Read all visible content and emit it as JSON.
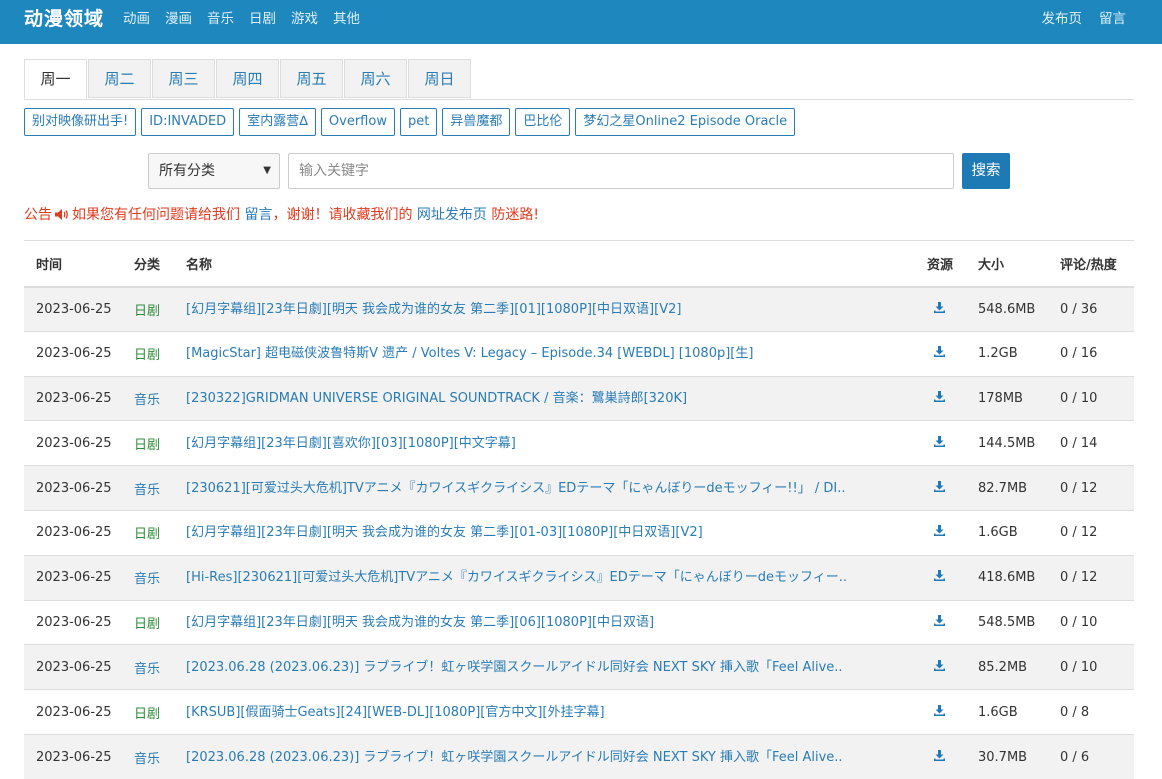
{
  "navbar": {
    "brand": "动漫领域",
    "left_links": [
      "动画",
      "漫画",
      "音乐",
      "日剧",
      "游戏",
      "其他"
    ],
    "right_links": [
      "发布页",
      "留言"
    ],
    "color": "#1e87bd"
  },
  "weekday_tabs": {
    "items": [
      "周一",
      "周二",
      "周三",
      "周四",
      "周五",
      "周六",
      "周日"
    ],
    "active": "周一"
  },
  "tags": [
    "别对映像研出手!",
    "ID:INVADED",
    "室内露营∆",
    "Overflow",
    "pet",
    "异兽魔都",
    "巴比伦",
    "梦幻之星Online2 Episode Oracle"
  ],
  "search": {
    "category_value": "所有分类",
    "placeholder": "输入关键字",
    "button_label": "搜索"
  },
  "notice": {
    "label": "公告",
    "text_before": "如果您有任何问题请给我们",
    "link1": "留言",
    "text_middle": "，谢谢！请收藏我们的",
    "link2": "网址发布页",
    "text_after": "防迷路!"
  },
  "table": {
    "headers": {
      "time": "时间",
      "category": "分类",
      "name": "名称",
      "resource": "资源",
      "size": "大小",
      "comments": "评论/热度"
    },
    "rows": [
      {
        "time": "2023-06-25",
        "category": "日剧",
        "name": "[幻月字幕组][23年日劇][明天 我会成为谁的女友 第二季][01][1080P][中日双语][V2]",
        "size": "548.6MB",
        "stats": "0 / 36"
      },
      {
        "time": "2023-06-25",
        "category": "日剧",
        "name": "[MagicStar] 超电磁侠波鲁特斯V 遗产 / Voltes V: Legacy – Episode.34 [WEBDL] [1080p][生]",
        "size": "1.2GB",
        "stats": "0 / 16"
      },
      {
        "time": "2023-06-25",
        "category": "音乐",
        "name": "[230322]GRIDMAN UNIVERSE ORIGINAL SOUNDTRACK / 音楽：鷺巣詩郎[320K]",
        "size": "178MB",
        "stats": "0 / 10"
      },
      {
        "time": "2023-06-25",
        "category": "日剧",
        "name": "[幻月字幕组][23年日劇][喜欢你][03][1080P][中文字幕]",
        "size": "144.5MB",
        "stats": "0 / 14"
      },
      {
        "time": "2023-06-25",
        "category": "音乐",
        "name": "[230621][可爱过头大危机]TVアニメ『カワイスギクライシス』EDテーマ「にゃんぼりーdeモッフィー!!」 / DI..",
        "size": "82.7MB",
        "stats": "0 / 12"
      },
      {
        "time": "2023-06-25",
        "category": "日剧",
        "name": "[幻月字幕组][23年日劇][明天 我会成为谁的女友 第二季][01-03][1080P][中日双语][V2]",
        "size": "1.6GB",
        "stats": "0 / 12"
      },
      {
        "time": "2023-06-25",
        "category": "音乐",
        "name": "[Hi-Res][230621][可爱过头大危机]TVアニメ『カワイスギクライシス』EDテーマ「にゃんぼりーdeモッフィー..",
        "size": "418.6MB",
        "stats": "0 / 12"
      },
      {
        "time": "2023-06-25",
        "category": "日剧",
        "name": "[幻月字幕组][23年日劇][明天 我会成为谁的女友 第二季][06][1080P][中日双语]",
        "size": "548.5MB",
        "stats": "0 / 10"
      },
      {
        "time": "2023-06-25",
        "category": "音乐",
        "name": "[2023.06.28 (2023.06.23)] ラブライブ！虹ヶ咲学園スクールアイドル同好会 NEXT SKY 挿入歌「Feel Alive..",
        "size": "85.2MB",
        "stats": "0 / 10"
      },
      {
        "time": "2023-06-25",
        "category": "日剧",
        "name": "[KRSUB][假面骑士Geats][24][WEB-DL][1080P][官方中文][外挂字幕]",
        "size": "1.6GB",
        "stats": "0 / 8"
      },
      {
        "time": "2023-06-25",
        "category": "音乐",
        "name": "[2023.06.28 (2023.06.23)] ラブライブ！虹ヶ咲学園スクールアイドル同好会 NEXT SKY 挿入歌「Feel Alive..",
        "size": "30.7MB",
        "stats": "0 / 6"
      }
    ]
  },
  "icons": {
    "download": "download-icon",
    "speaker": "speaker-icon",
    "select_arrow": "chevron-down-icon"
  }
}
